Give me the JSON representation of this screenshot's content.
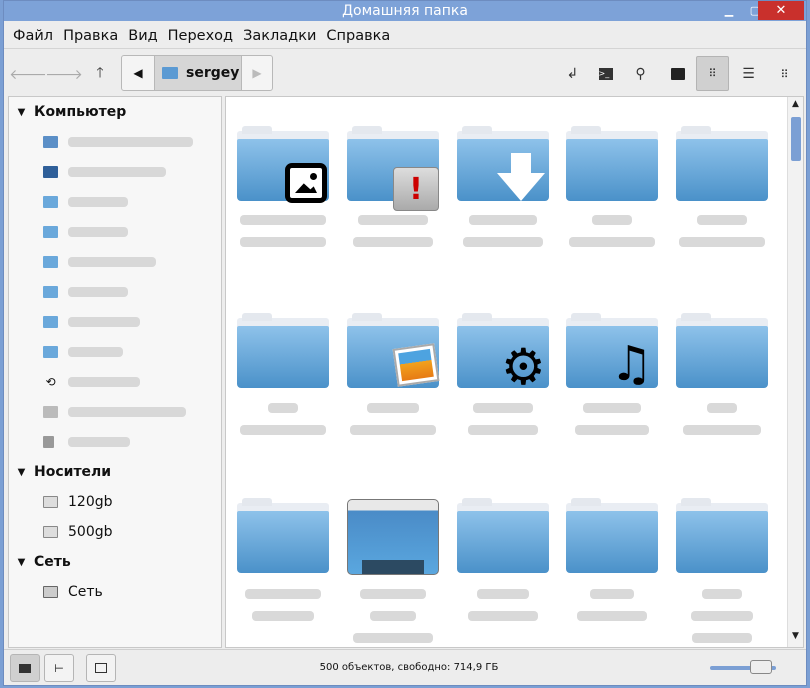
{
  "window": {
    "title": "Домашняя папка",
    "minimize": "▁",
    "maximize": "▢",
    "close": "✕"
  },
  "menu": [
    "Файл",
    "Правка",
    "Вид",
    "Переход",
    "Закладки",
    "Справка"
  ],
  "toolbar": {
    "back_icon": "arrow-left-icon",
    "forward_icon": "arrow-right-icon",
    "up_icon": "arrow-up-icon",
    "breadcrumb_current": "sergey",
    "right_icons": [
      "open-location-icon",
      "terminal-icon",
      "search-icon",
      "image-preview-icon",
      "icon-view-icon",
      "list-view-icon",
      "compact-view-icon"
    ]
  },
  "sidebar": {
    "sections": [
      {
        "title": "Компьютер",
        "items": [
          {
            "icon": "home-icon",
            "label": ""
          },
          {
            "icon": "desktop-icon",
            "label": ""
          },
          {
            "icon": "folder-icon",
            "label": ""
          },
          {
            "icon": "folder-icon",
            "label": ""
          },
          {
            "icon": "folder-icon",
            "label": ""
          },
          {
            "icon": "folder-icon",
            "label": ""
          },
          {
            "icon": "folder-icon",
            "label": ""
          },
          {
            "icon": "folder-icon",
            "label": ""
          },
          {
            "icon": "recent-icon",
            "label": ""
          },
          {
            "icon": "drive-icon",
            "label": ""
          },
          {
            "icon": "trash-icon",
            "label": ""
          }
        ]
      },
      {
        "title": "Носители",
        "items": [
          {
            "icon": "drive-icon",
            "label": "120gb"
          },
          {
            "icon": "drive-icon",
            "label": "500gb"
          }
        ]
      },
      {
        "title": "Сеть",
        "items": [
          {
            "icon": "network-icon",
            "label": "Сеть"
          }
        ]
      }
    ]
  },
  "grid": {
    "rows": [
      [
        {
          "emblem": "image-emblem"
        },
        {
          "emblem": "warning-emblem"
        },
        {
          "emblem": "download-emblem"
        },
        {
          "emblem": ""
        },
        {
          "emblem": ""
        }
      ],
      [
        {
          "emblem": ""
        },
        {
          "emblem": "pictures-emblem"
        },
        {
          "emblem": "settings-emblem"
        },
        {
          "emblem": "music-emblem"
        },
        {
          "emblem": ""
        }
      ],
      [
        {
          "emblem": ""
        },
        {
          "emblem": "desktop-emblem"
        },
        {
          "emblem": ""
        },
        {
          "emblem": ""
        },
        {
          "emblem": ""
        }
      ]
    ]
  },
  "status": {
    "text": "500 объектов, свободно: 714,9 ГБ",
    "zoom_level": 0.75
  }
}
